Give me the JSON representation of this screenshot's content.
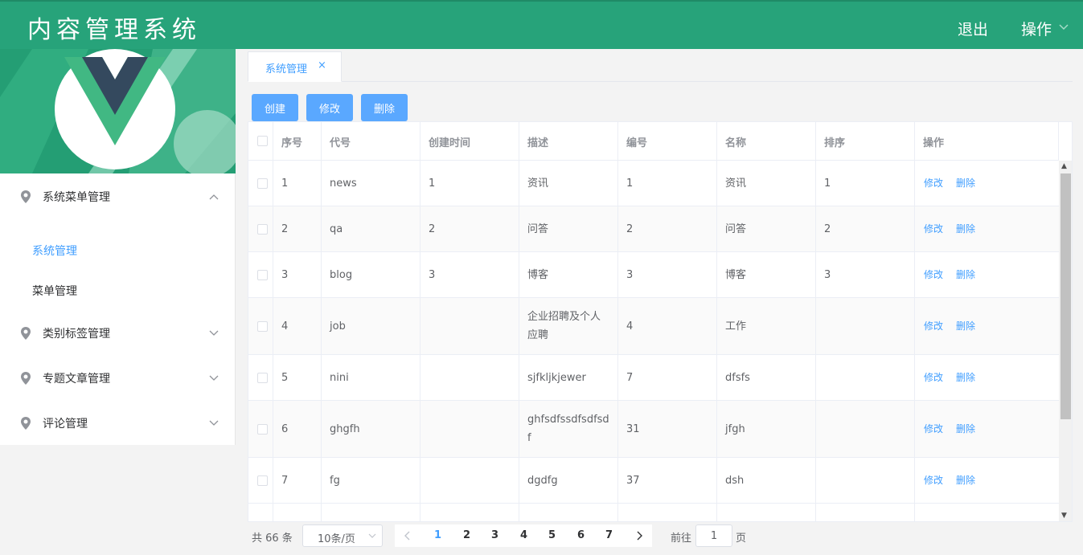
{
  "header": {
    "title": "内容管理系统",
    "logout": "退出",
    "ops": "操作",
    "color": "#27a37a"
  },
  "sidebar": {
    "menus": [
      {
        "label": "系统菜单管理",
        "expanded": true
      },
      {
        "label": "类别标签管理",
        "expanded": false
      },
      {
        "label": "专题文章管理",
        "expanded": false
      },
      {
        "label": "评论管理",
        "expanded": false
      }
    ],
    "submenu": [
      {
        "label": "系统管理",
        "active": true
      },
      {
        "label": "菜单管理",
        "active": false
      }
    ]
  },
  "tabs": [
    {
      "label": "系统管理",
      "close": "×"
    }
  ],
  "toolbar": {
    "create": "创建",
    "edit": "修改",
    "delete": "删除"
  },
  "table": {
    "columns": [
      "序号",
      "代号",
      "创建时间",
      "描述",
      "编号",
      "名称",
      "排序",
      "操作"
    ],
    "rows": [
      {
        "seq": "1",
        "code": "news",
        "created": "1",
        "desc": "资讯",
        "no": "1",
        "name": "资讯",
        "sort": "1"
      },
      {
        "seq": "2",
        "code": "qa",
        "created": "2",
        "desc": "问答",
        "no": "2",
        "name": "问答",
        "sort": "2"
      },
      {
        "seq": "3",
        "code": "blog",
        "created": "3",
        "desc": "博客",
        "no": "3",
        "name": "博客",
        "sort": "3"
      },
      {
        "seq": "4",
        "code": "job",
        "created": "",
        "desc": "企业招聘及个人应聘",
        "no": "4",
        "name": "工作",
        "sort": ""
      },
      {
        "seq": "5",
        "code": "nini",
        "created": "",
        "desc": "sjfkljkjewer",
        "no": "7",
        "name": "dfsfs",
        "sort": ""
      },
      {
        "seq": "6",
        "code": "ghgfh",
        "created": "",
        "desc": "ghfsdfssdfsdfsdf",
        "no": "31",
        "name": "jfgh",
        "sort": ""
      },
      {
        "seq": "7",
        "code": "fg",
        "created": "",
        "desc": "dgdfg",
        "no": "37",
        "name": "dsh",
        "sort": ""
      }
    ],
    "row_edit": "修改",
    "row_delete": "删除"
  },
  "pagination": {
    "total": "共 66 条",
    "page_size": "10条/页",
    "pages": [
      "1",
      "2",
      "3",
      "4",
      "5",
      "6",
      "7"
    ],
    "current": "1",
    "goto_label": "前往",
    "goto_value": "1",
    "goto_suffix": "页"
  },
  "colors": {
    "accent": "#409eff",
    "button": "#5aa8ff"
  }
}
